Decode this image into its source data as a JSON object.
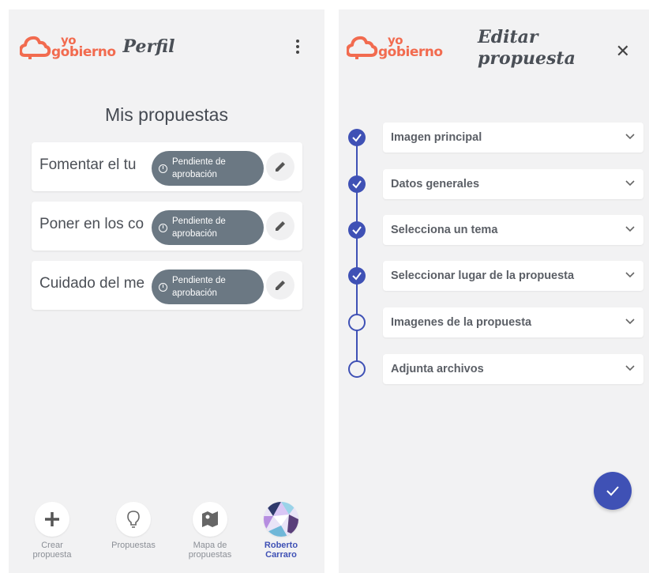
{
  "colors": {
    "brand": "#f26b4f",
    "accent": "#3f51b5",
    "badge": "#6b7883"
  },
  "left_screen": {
    "logo": {
      "line1": "yo",
      "line2": "gobierno"
    },
    "header_title": "Perfil",
    "menu_icon": "more-vertical-icon",
    "section_title": "Mis propuestas",
    "proposals": [
      {
        "title": "Fomentar el tu",
        "status_line1": "Pendiente de",
        "status_line2": "aprobación"
      },
      {
        "title": "Poner en los co",
        "status_line1": "Pendiente de",
        "status_line2": "aprobación"
      },
      {
        "title": "Cuidado del me",
        "status_line1": "Pendiente de",
        "status_line2": "aprobación"
      }
    ],
    "bottom_nav": [
      {
        "line1": "Crear",
        "line2": "propuesta",
        "icon": "plus-icon"
      },
      {
        "line1": "Propuestas",
        "line2": "",
        "icon": "lightbulb-icon"
      },
      {
        "line1": "Mapa de",
        "line2": "propuestas",
        "icon": "map-icon"
      },
      {
        "line1": "Roberto",
        "line2": "Carraro",
        "icon": "avatar"
      }
    ]
  },
  "right_screen": {
    "logo": {
      "line1": "yo",
      "line2": "gobierno"
    },
    "header_line1": "Editar",
    "header_line2": "propuesta",
    "close_icon": "close-icon",
    "steps": [
      {
        "label": "Imagen principal",
        "completed": true
      },
      {
        "label": "Datos generales",
        "completed": true
      },
      {
        "label": "Selecciona un tema",
        "completed": true
      },
      {
        "label": "Seleccionar lugar de la propuesta",
        "completed": true
      },
      {
        "label": "Imagenes de la propuesta",
        "completed": false
      },
      {
        "label": "Adjunta archivos",
        "completed": false
      }
    ],
    "fab_icon": "check-icon"
  }
}
